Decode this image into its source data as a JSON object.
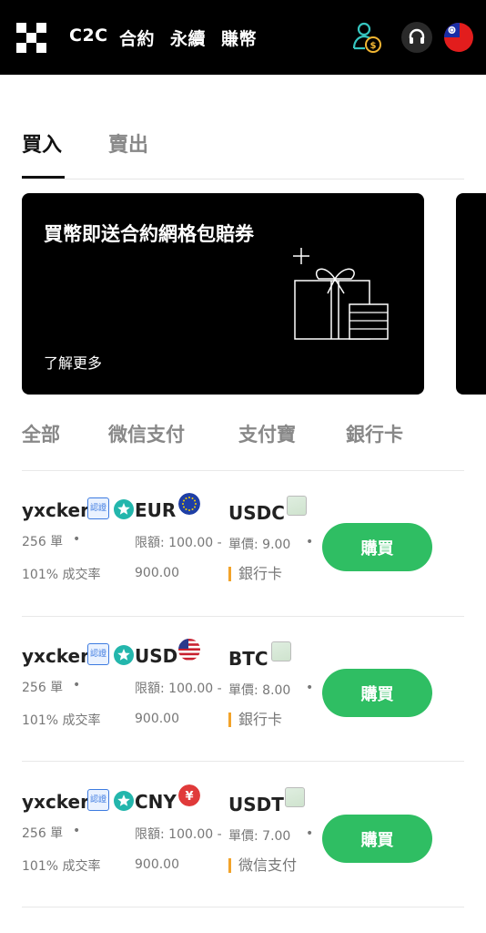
{
  "header": {
    "nav": [
      "C2C",
      "合約",
      "永續",
      "賺幣"
    ],
    "icons": [
      "logo-icon",
      "user-coin-icon",
      "support-icon",
      "taiwan-flag-icon"
    ]
  },
  "tabs": [
    {
      "label": "買入",
      "active": true
    },
    {
      "label": "賣出",
      "active": false
    }
  ],
  "banner": {
    "title": "買幣即送合約網格包賠券",
    "link": "了解更多"
  },
  "filters": [
    "全部",
    "微信支付",
    "支付寶",
    "銀行卡"
  ],
  "listings": [
    {
      "merchant": "yxcker",
      "badge": "認證",
      "fiat": "EUR",
      "flag": "eu-flag-icon",
      "crypto": "USDC",
      "orders": "256 單",
      "rate": "101% 成交率",
      "limit_label": "限額: 100.00 -",
      "limit_max": "900.00",
      "price": "單價: 9.00",
      "payment": "銀行卡",
      "button": "購買"
    },
    {
      "merchant": "yxcker",
      "badge": "認證",
      "fiat": "USD",
      "flag": "us-flag-icon",
      "crypto": "BTC",
      "orders": "256 單",
      "rate": "101% 成交率",
      "limit_label": "限額: 100.00 -",
      "limit_max": "900.00",
      "price": "單價: 8.00",
      "payment": "銀行卡",
      "button": "購買"
    },
    {
      "merchant": "yxcker",
      "badge": "認證",
      "fiat": "CNY",
      "flag": "yen-icon",
      "crypto": "USDT",
      "orders": "256 單",
      "rate": "101% 成交率",
      "limit_label": "限額: 100.00 -",
      "limit_max": "900.00",
      "price": "單價: 7.00",
      "payment": "微信支付",
      "button": "購買"
    }
  ],
  "colors": {
    "buy_button": "#2fbe63",
    "payment_marker": "#f2a32a",
    "header_bg": "#000000"
  }
}
